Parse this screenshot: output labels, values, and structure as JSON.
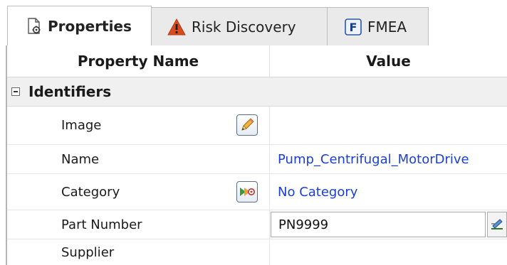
{
  "tabs": [
    {
      "label": "Properties",
      "icon": "properties-icon",
      "active": true
    },
    {
      "label": "Risk Discovery",
      "icon": "warning-icon",
      "active": false
    },
    {
      "label": "FMEA",
      "icon": "fmea-icon",
      "icon_letter": "F",
      "active": false
    }
  ],
  "grid": {
    "header": {
      "name": "Property Name",
      "value": "Value"
    },
    "group": {
      "label": "Identifiers",
      "expanded": true
    },
    "rows": {
      "image": {
        "name": "Image",
        "value": "",
        "button_icon": "pencil-icon"
      },
      "name": {
        "name": "Name",
        "value": "Pump_Centrifugal_MotorDrive"
      },
      "category": {
        "name": "Category",
        "value": "No Category",
        "button_icon": "category-picker-icon"
      },
      "part_number": {
        "name": "Part Number",
        "value": "PN9999",
        "button_icon": "edit-list-icon"
      },
      "supplier": {
        "name": "Supplier",
        "value": ""
      }
    }
  },
  "colors": {
    "value_link": "#1a3fd6",
    "group_background": "#f0f0f0",
    "tab_inactive": "#eaeaea",
    "warning": "#d94a1e"
  }
}
